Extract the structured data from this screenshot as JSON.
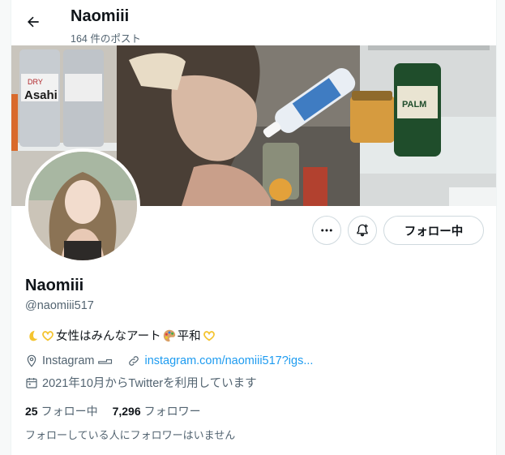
{
  "header": {
    "title": "Naomiii",
    "post_count": "164 件のポスト"
  },
  "banner": {
    "can_brand": "Asahi",
    "can_text": "DRY",
    "bottle_text": "PALM"
  },
  "actions": {
    "follow_label": "フォロー中"
  },
  "profile": {
    "name": "Naomiii",
    "handle": "@naomiii517",
    "bio_text": "女性はみんなアート",
    "bio_text2": "平和",
    "location": "Instagram",
    "link": "instagram.com/naomiii517?igs...",
    "joined": "2021年10月からTwitterを利用しています"
  },
  "stats": {
    "following_count": "25",
    "following_label": "フォロー中",
    "followers_count": "7,296",
    "followers_label": "フォロワー"
  },
  "footer": {
    "no_common_followers": "フォローしている人にフォロワーはいません"
  },
  "colors": {
    "accent": "#1d9bf0",
    "secondary_text": "#536471",
    "border": "#cfd9de"
  }
}
